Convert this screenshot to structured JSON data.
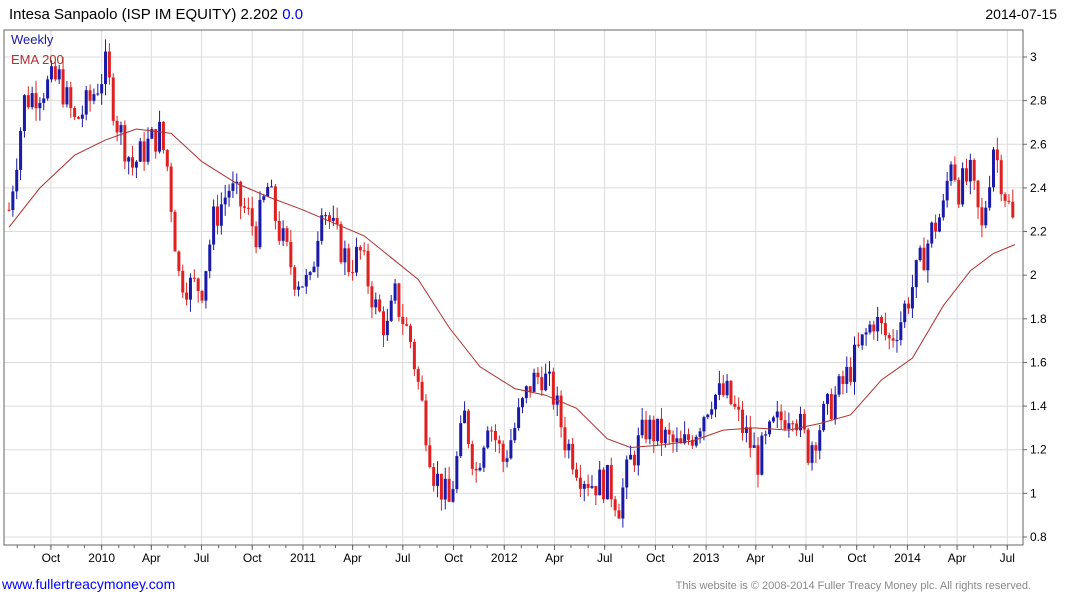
{
  "header": {
    "title": "Intesa Sanpaolo (ISP IM EQUITY) 2.202",
    "change": "0.0",
    "date": "2014-07-15"
  },
  "footer": {
    "site": "www.fullertreacymoney.com",
    "copyright": "This website is © 2008-2014 Fuller Treacy Money plc. All rights reserved."
  },
  "chart_data": {
    "type": "candlestick",
    "frequency": "Weekly",
    "ylim": [
      0.8,
      3.05
    ],
    "grid": true,
    "y_ticks": [
      "0.8",
      "1",
      "1.2",
      "1.4",
      "1.6",
      "1.8",
      "2",
      "2.2",
      "2.4",
      "2.6",
      "2.8",
      "3"
    ],
    "x_ticks": [
      "Oct",
      "2010",
      "Apr",
      "Jul",
      "Oct",
      "2011",
      "Apr",
      "Jul",
      "Oct",
      "2012",
      "Apr",
      "Jul",
      "Oct",
      "2013",
      "Apr",
      "Jul",
      "Oct",
      "2014",
      "Apr",
      "Jul"
    ],
    "legend": [
      "Weekly",
      "EMA 200"
    ],
    "colors": {
      "up": "#1a1aa8",
      "down": "#e02020",
      "ema": "#b03030",
      "grid": "#dcdcdc"
    },
    "close_path": [
      [
        "2009-07-17",
        2.3
      ],
      [
        "2009-08-14",
        2.8
      ],
      [
        "2009-09-11",
        2.85
      ],
      [
        "2009-10-16",
        2.9
      ],
      [
        "2009-11-13",
        2.7
      ],
      [
        "2009-12-11",
        2.8
      ],
      [
        "2010-01-08",
        2.95
      ],
      [
        "2010-01-29",
        2.7
      ],
      [
        "2010-02-26",
        2.5
      ],
      [
        "2010-03-26",
        2.6
      ],
      [
        "2010-04-16",
        2.65
      ],
      [
        "2010-04-30",
        2.5
      ],
      [
        "2010-05-21",
        2.0
      ],
      [
        "2010-06-11",
        1.95
      ],
      [
        "2010-07-02",
        1.95
      ],
      [
        "2010-07-23",
        2.25
      ],
      [
        "2010-08-20",
        2.4
      ],
      [
        "2010-09-17",
        2.3
      ],
      [
        "2010-10-08",
        2.2
      ],
      [
        "2010-10-29",
        2.4
      ],
      [
        "2010-11-19",
        2.2
      ],
      [
        "2010-12-17",
        2.0
      ],
      [
        "2011-01-14",
        1.95
      ],
      [
        "2011-02-04",
        2.35
      ],
      [
        "2011-02-25",
        2.2
      ],
      [
        "2011-03-25",
        2.05
      ],
      [
        "2011-04-15",
        2.1
      ],
      [
        "2011-05-13",
        1.85
      ],
      [
        "2011-06-03",
        1.75
      ],
      [
        "2011-06-17",
        1.9
      ],
      [
        "2011-07-15",
        1.7
      ],
      [
        "2011-08-05",
        1.4
      ],
      [
        "2011-08-26",
        1.1
      ],
      [
        "2011-09-23",
        0.95
      ],
      [
        "2011-10-21",
        1.35
      ],
      [
        "2011-11-11",
        1.1
      ],
      [
        "2011-12-02",
        1.35
      ],
      [
        "2011-12-30",
        1.15
      ],
      [
        "2012-01-20",
        1.3
      ],
      [
        "2012-02-17",
        1.5
      ],
      [
        "2012-03-09",
        1.55
      ],
      [
        "2012-03-30",
        1.45
      ],
      [
        "2012-04-20",
        1.25
      ],
      [
        "2012-05-18",
        1.1
      ],
      [
        "2012-06-08",
        1.05
      ],
      [
        "2012-07-06",
        1.05
      ],
      [
        "2012-07-27",
        0.95
      ],
      [
        "2012-08-17",
        1.15
      ],
      [
        "2012-09-14",
        1.3
      ],
      [
        "2012-10-19",
        1.25
      ],
      [
        "2012-11-16",
        1.2
      ],
      [
        "2012-12-14",
        1.3
      ],
      [
        "2013-01-11",
        1.45
      ],
      [
        "2013-02-08",
        1.45
      ],
      [
        "2013-03-08",
        1.3
      ],
      [
        "2013-04-05",
        1.15
      ],
      [
        "2013-05-03",
        1.3
      ],
      [
        "2013-06-07",
        1.4
      ],
      [
        "2013-07-05",
        1.2
      ],
      [
        "2013-08-02",
        1.35
      ],
      [
        "2013-09-06",
        1.5
      ],
      [
        "2013-10-04",
        1.65
      ],
      [
        "2013-11-01",
        1.8
      ],
      [
        "2013-11-29",
        1.7
      ],
      [
        "2013-12-20",
        1.8
      ],
      [
        "2014-01-17",
        2.0
      ],
      [
        "2014-02-14",
        2.2
      ],
      [
        "2014-03-07",
        2.3
      ],
      [
        "2014-03-21",
        2.55
      ],
      [
        "2014-04-04",
        2.4
      ],
      [
        "2014-04-25",
        2.45
      ],
      [
        "2014-05-16",
        2.2
      ],
      [
        "2014-06-06",
        2.6
      ],
      [
        "2014-06-20",
        2.45
      ],
      [
        "2014-07-15",
        2.202
      ]
    ],
    "ema_200": [
      [
        "2009-07-17",
        2.22
      ],
      [
        "2009-09-11",
        2.4
      ],
      [
        "2009-11-13",
        2.55
      ],
      [
        "2010-01-08",
        2.62
      ],
      [
        "2010-03-05",
        2.67
      ],
      [
        "2010-05-07",
        2.65
      ],
      [
        "2010-07-02",
        2.52
      ],
      [
        "2010-09-03",
        2.42
      ],
      [
        "2010-10-29",
        2.36
      ],
      [
        "2010-12-31",
        2.3
      ],
      [
        "2011-02-25",
        2.24
      ],
      [
        "2011-04-22",
        2.18
      ],
      [
        "2011-06-10",
        2.08
      ],
      [
        "2011-07-29",
        1.98
      ],
      [
        "2011-09-23",
        1.76
      ],
      [
        "2011-11-18",
        1.58
      ],
      [
        "2012-01-20",
        1.48
      ],
      [
        "2012-03-16",
        1.45
      ],
      [
        "2012-05-11",
        1.39
      ],
      [
        "2012-07-06",
        1.25
      ],
      [
        "2012-08-17",
        1.21
      ],
      [
        "2012-10-05",
        1.22
      ],
      [
        "2012-12-07",
        1.24
      ],
      [
        "2013-02-01",
        1.29
      ],
      [
        "2013-03-29",
        1.3
      ],
      [
        "2013-05-31",
        1.29
      ],
      [
        "2013-07-26",
        1.32
      ],
      [
        "2013-09-20",
        1.36
      ],
      [
        "2013-11-15",
        1.52
      ],
      [
        "2014-01-10",
        1.62
      ],
      [
        "2014-03-07",
        1.86
      ],
      [
        "2014-04-25",
        2.02
      ],
      [
        "2014-06-06",
        2.1
      ],
      [
        "2014-07-15",
        2.14
      ]
    ]
  }
}
